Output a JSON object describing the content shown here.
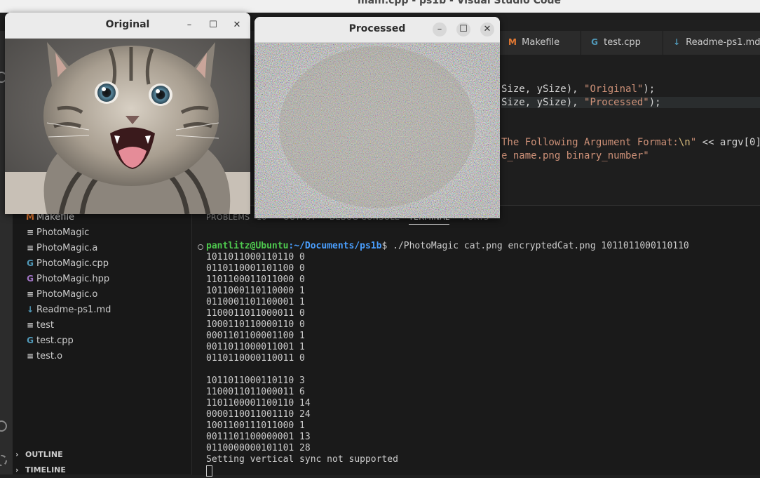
{
  "vscode": {
    "title": "main.cpp - ps1b - Visual Studio Code",
    "tabs": [
      {
        "icon": "M",
        "label": "Makefile",
        "color": "#e37933"
      },
      {
        "icon": "G",
        "label": "test.cpp",
        "color": "#519aba"
      },
      {
        "icon": "↓",
        "label": "Readme-ps1.md",
        "color": "#519aba"
      }
    ],
    "code": {
      "line1a": "Size, ySize), ",
      "line1b": "\"Original\"",
      "line1c": ");",
      "line2a": "Size, ySize), ",
      "line2b": "\"Processed\"",
      "line2c": ");",
      "line3a": "The Following Argument Format:",
      "line3b": "\\n",
      "line3c": "\" ",
      "line3d": "<<",
      "line3e": " argv[0]",
      "line4": "e_name.png binary_number\""
    }
  },
  "explorer": {
    "files": [
      {
        "icon": "M",
        "label": "Makefile",
        "color": "#e37933"
      },
      {
        "icon": "≡",
        "label": "PhotoMagic",
        "color": "#cccccc"
      },
      {
        "icon": "≡",
        "label": "PhotoMagic.a",
        "color": "#cccccc"
      },
      {
        "icon": "G",
        "label": "PhotoMagic.cpp",
        "color": "#519aba"
      },
      {
        "icon": "G",
        "label": "PhotoMagic.hpp",
        "color": "#a074c4"
      },
      {
        "icon": "≡",
        "label": "PhotoMagic.o",
        "color": "#cccccc"
      },
      {
        "icon": "↓",
        "label": "Readme-ps1.md",
        "color": "#519aba"
      },
      {
        "icon": "≡",
        "label": "test",
        "color": "#cccccc"
      },
      {
        "icon": "G",
        "label": "test.cpp",
        "color": "#519aba"
      },
      {
        "icon": "≡",
        "label": "test.o",
        "color": "#cccccc"
      }
    ],
    "sections": [
      "OUTLINE",
      "TIMELINE"
    ]
  },
  "panel": {
    "tabs": [
      "PROBLEMS",
      "OUTPUT",
      "DEBUG CONSOLE",
      "TERMINAL",
      "PORTS"
    ],
    "problems_count": "10"
  },
  "terminal": {
    "prompt_user": "pantlitz@Ubuntu",
    "prompt_path": ":~/Documents/ps1b",
    "command": "$ ./PhotoMagic cat.png encryptedCat.png 1011011000110110",
    "lines1": [
      "1011011000110110 0",
      "0110110001101100 0",
      "1101100011011000 0",
      "1011000110110000 1",
      "0110001101100001 1",
      "1100011011000011 0",
      "1000110110000110 0",
      "0001101100001100 1",
      "0011011000011001 1",
      "0110110000110011 0"
    ],
    "lines2": [
      "1011011000110110 3",
      "1100011011000011 6",
      "1101100001100110 14",
      "0000110011001110 24",
      "1001100111011000 1",
      "0011101100000001 13",
      "0110000000101101 28"
    ],
    "last_line": "Setting vertical sync not supported"
  },
  "windows": {
    "original": {
      "title": "Original"
    },
    "processed": {
      "title": "Processed"
    },
    "controls": {
      "minimize": "–",
      "maximize": "☐",
      "close": "✕"
    }
  }
}
